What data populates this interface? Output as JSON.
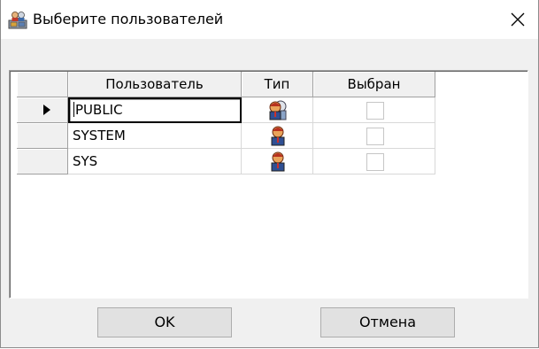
{
  "window": {
    "title": "Выберите пользователей",
    "title_icon": "users-dialog-icon",
    "close_icon": "close-icon"
  },
  "grid": {
    "columns": [
      "Пользователь",
      "Тип",
      "Выбран"
    ],
    "current_row_indicator": "▶",
    "rows": [
      {
        "user": "PUBLIC",
        "type_icon": "group-users-icon",
        "selected": false,
        "current": true
      },
      {
        "user": "SYSTEM",
        "type_icon": "user-icon",
        "selected": false,
        "current": false
      },
      {
        "user": "SYS",
        "type_icon": "user-icon",
        "selected": false,
        "current": false
      }
    ]
  },
  "buttons": {
    "ok_label": "OK",
    "cancel_label": "Отмена"
  }
}
